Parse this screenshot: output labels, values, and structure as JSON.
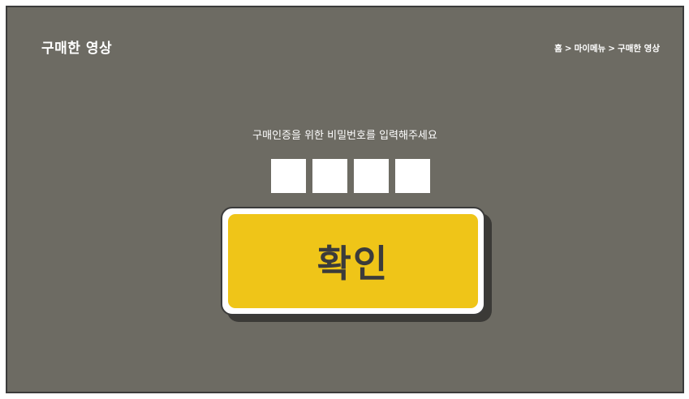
{
  "header": {
    "title": "구매한 영상",
    "breadcrumb": [
      "홈",
      "마이메뉴",
      "구매한 영상"
    ],
    "breadcrumb_separator": ">"
  },
  "auth": {
    "instruction": "구매인증을 위한 비밀번호를 입력해주세요",
    "pin_digits": [
      "",
      "",
      "",
      ""
    ],
    "confirm_label": "확인"
  },
  "colors": {
    "background": "#6d6b63",
    "confirm_button": "#efc518",
    "text": "#ffffff"
  }
}
